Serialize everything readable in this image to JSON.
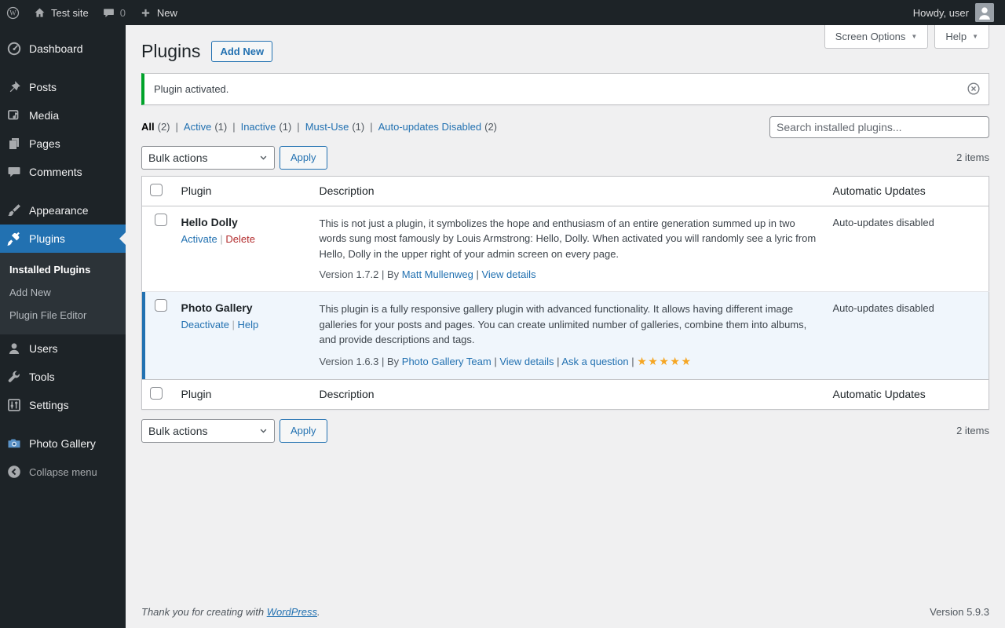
{
  "colors": {
    "accent_blue": "#2271b1",
    "notice_green": "#00a32a",
    "delete_red": "#b32d2e",
    "star_orange": "#f5a623",
    "active_row_bg": "#f0f6fc",
    "sidebar_bg": "#1d2327"
  },
  "glyphs": {
    "caret_down": "▼"
  },
  "admin_bar": {
    "logo_icon": "wordpress-logo-icon",
    "site_name": "Test site",
    "site_icon": "home-icon",
    "comments_icon": "comment-icon",
    "comments_count": "0",
    "new_icon": "plus-icon",
    "new_label": "New",
    "howdy": "Howdy, user",
    "avatar_icon": "avatar-icon"
  },
  "sidebar": {
    "items": [
      {
        "label": "Dashboard",
        "icon": "gauge-icon"
      },
      {
        "label": "Posts",
        "icon": "pin-icon",
        "separator_before": true
      },
      {
        "label": "Media",
        "icon": "media-icon"
      },
      {
        "label": "Pages",
        "icon": "pages-icon"
      },
      {
        "label": "Comments",
        "icon": "comments-icon"
      },
      {
        "label": "Appearance",
        "icon": "brush-icon",
        "separator_before": true
      },
      {
        "label": "Plugins",
        "icon": "plugin-icon",
        "active": true,
        "submenu": [
          {
            "label": "Installed Plugins",
            "current": true
          },
          {
            "label": "Add New"
          },
          {
            "label": "Plugin File Editor"
          }
        ]
      },
      {
        "label": "Users",
        "icon": "users-icon"
      },
      {
        "label": "Tools",
        "icon": "wrench-icon"
      },
      {
        "label": "Settings",
        "icon": "sliders-icon"
      },
      {
        "label": "Photo Gallery",
        "icon": "camera-icon",
        "separator_before": true
      },
      {
        "label": "Collapse menu",
        "icon": "collapse-icon",
        "muted": true
      }
    ]
  },
  "header": {
    "title": "Plugins",
    "add_new_label": "Add New",
    "screen_options_label": "Screen Options",
    "help_label": "Help"
  },
  "notice": {
    "message": "Plugin activated.",
    "dismiss_icon": "dismiss-icon"
  },
  "filters": [
    {
      "label": "All",
      "count": "(2)",
      "current": true
    },
    {
      "label": "Active",
      "count": "(1)"
    },
    {
      "label": "Inactive",
      "count": "(1)"
    },
    {
      "label": "Must-Use",
      "count": "(1)"
    },
    {
      "label": "Auto-updates Disabled",
      "count": "(2)"
    }
  ],
  "search": {
    "placeholder": "Search installed plugins..."
  },
  "tablenav": {
    "bulk_actions_label": "Bulk actions",
    "apply_label": "Apply",
    "items_count": "2 items"
  },
  "table": {
    "headers": {
      "plugin": "Plugin",
      "description": "Description",
      "auto_updates": "Automatic Updates"
    },
    "rows": [
      {
        "name": "Hello Dolly",
        "active": false,
        "actions": [
          {
            "label": "Activate",
            "style": "link"
          },
          {
            "label": "Delete",
            "style": "delete"
          }
        ],
        "description": "This is not just a plugin, it symbolizes the hope and enthusiasm of an entire generation summed up in two words sung most famously by Louis Armstrong: Hello, Dolly. When activated you will randomly see a lyric from Hello, Dolly in the upper right of your admin screen on every page.",
        "version": "Version 1.7.2",
        "by_label": "By",
        "author": "Matt Mullenweg",
        "meta_links": [
          "View details"
        ],
        "rating_stars": 0,
        "auto_updates": "Auto-updates disabled"
      },
      {
        "name": "Photo Gallery",
        "active": true,
        "actions": [
          {
            "label": "Deactivate",
            "style": "link"
          },
          {
            "label": "Help",
            "style": "link"
          }
        ],
        "description": "This plugin is a fully responsive gallery plugin with advanced functionality. It allows having different image galleries for your posts and pages. You can create unlimited number of galleries, combine them into albums, and provide descriptions and tags.",
        "version": "Version 1.6.3",
        "by_label": "By",
        "author": "Photo Gallery Team",
        "meta_links": [
          "View details",
          "Ask a question"
        ],
        "rating_stars": 5,
        "auto_updates": "Auto-updates disabled"
      }
    ]
  },
  "footer": {
    "thanks_text": "Thank you for creating with",
    "wordpress_link": "WordPress",
    "suffix": ".",
    "version": "Version 5.9.3"
  }
}
